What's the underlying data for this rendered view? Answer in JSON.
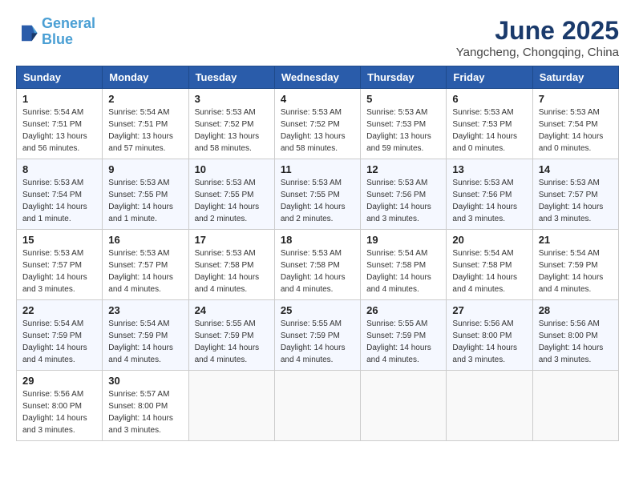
{
  "header": {
    "logo_line1": "General",
    "logo_line2": "Blue",
    "title": "June 2025",
    "subtitle": "Yangcheng, Chongqing, China"
  },
  "weekdays": [
    "Sunday",
    "Monday",
    "Tuesday",
    "Wednesday",
    "Thursday",
    "Friday",
    "Saturday"
  ],
  "weeks": [
    [
      {
        "day": "1",
        "sunrise": "5:54 AM",
        "sunset": "7:51 PM",
        "daylight": "13 hours and 56 minutes."
      },
      {
        "day": "2",
        "sunrise": "5:54 AM",
        "sunset": "7:51 PM",
        "daylight": "13 hours and 57 minutes."
      },
      {
        "day": "3",
        "sunrise": "5:53 AM",
        "sunset": "7:52 PM",
        "daylight": "13 hours and 58 minutes."
      },
      {
        "day": "4",
        "sunrise": "5:53 AM",
        "sunset": "7:52 PM",
        "daylight": "13 hours and 58 minutes."
      },
      {
        "day": "5",
        "sunrise": "5:53 AM",
        "sunset": "7:53 PM",
        "daylight": "13 hours and 59 minutes."
      },
      {
        "day": "6",
        "sunrise": "5:53 AM",
        "sunset": "7:53 PM",
        "daylight": "14 hours and 0 minutes."
      },
      {
        "day": "7",
        "sunrise": "5:53 AM",
        "sunset": "7:54 PM",
        "daylight": "14 hours and 0 minutes."
      }
    ],
    [
      {
        "day": "8",
        "sunrise": "5:53 AM",
        "sunset": "7:54 PM",
        "daylight": "14 hours and 1 minute."
      },
      {
        "day": "9",
        "sunrise": "5:53 AM",
        "sunset": "7:55 PM",
        "daylight": "14 hours and 1 minute."
      },
      {
        "day": "10",
        "sunrise": "5:53 AM",
        "sunset": "7:55 PM",
        "daylight": "14 hours and 2 minutes."
      },
      {
        "day": "11",
        "sunrise": "5:53 AM",
        "sunset": "7:55 PM",
        "daylight": "14 hours and 2 minutes."
      },
      {
        "day": "12",
        "sunrise": "5:53 AM",
        "sunset": "7:56 PM",
        "daylight": "14 hours and 3 minutes."
      },
      {
        "day": "13",
        "sunrise": "5:53 AM",
        "sunset": "7:56 PM",
        "daylight": "14 hours and 3 minutes."
      },
      {
        "day": "14",
        "sunrise": "5:53 AM",
        "sunset": "7:57 PM",
        "daylight": "14 hours and 3 minutes."
      }
    ],
    [
      {
        "day": "15",
        "sunrise": "5:53 AM",
        "sunset": "7:57 PM",
        "daylight": "14 hours and 3 minutes."
      },
      {
        "day": "16",
        "sunrise": "5:53 AM",
        "sunset": "7:57 PM",
        "daylight": "14 hours and 4 minutes."
      },
      {
        "day": "17",
        "sunrise": "5:53 AM",
        "sunset": "7:58 PM",
        "daylight": "14 hours and 4 minutes."
      },
      {
        "day": "18",
        "sunrise": "5:53 AM",
        "sunset": "7:58 PM",
        "daylight": "14 hours and 4 minutes."
      },
      {
        "day": "19",
        "sunrise": "5:54 AM",
        "sunset": "7:58 PM",
        "daylight": "14 hours and 4 minutes."
      },
      {
        "day": "20",
        "sunrise": "5:54 AM",
        "sunset": "7:58 PM",
        "daylight": "14 hours and 4 minutes."
      },
      {
        "day": "21",
        "sunrise": "5:54 AM",
        "sunset": "7:59 PM",
        "daylight": "14 hours and 4 minutes."
      }
    ],
    [
      {
        "day": "22",
        "sunrise": "5:54 AM",
        "sunset": "7:59 PM",
        "daylight": "14 hours and 4 minutes."
      },
      {
        "day": "23",
        "sunrise": "5:54 AM",
        "sunset": "7:59 PM",
        "daylight": "14 hours and 4 minutes."
      },
      {
        "day": "24",
        "sunrise": "5:55 AM",
        "sunset": "7:59 PM",
        "daylight": "14 hours and 4 minutes."
      },
      {
        "day": "25",
        "sunrise": "5:55 AM",
        "sunset": "7:59 PM",
        "daylight": "14 hours and 4 minutes."
      },
      {
        "day": "26",
        "sunrise": "5:55 AM",
        "sunset": "7:59 PM",
        "daylight": "14 hours and 4 minutes."
      },
      {
        "day": "27",
        "sunrise": "5:56 AM",
        "sunset": "8:00 PM",
        "daylight": "14 hours and 3 minutes."
      },
      {
        "day": "28",
        "sunrise": "5:56 AM",
        "sunset": "8:00 PM",
        "daylight": "14 hours and 3 minutes."
      }
    ],
    [
      {
        "day": "29",
        "sunrise": "5:56 AM",
        "sunset": "8:00 PM",
        "daylight": "14 hours and 3 minutes."
      },
      {
        "day": "30",
        "sunrise": "5:57 AM",
        "sunset": "8:00 PM",
        "daylight": "14 hours and 3 minutes."
      },
      null,
      null,
      null,
      null,
      null
    ]
  ]
}
